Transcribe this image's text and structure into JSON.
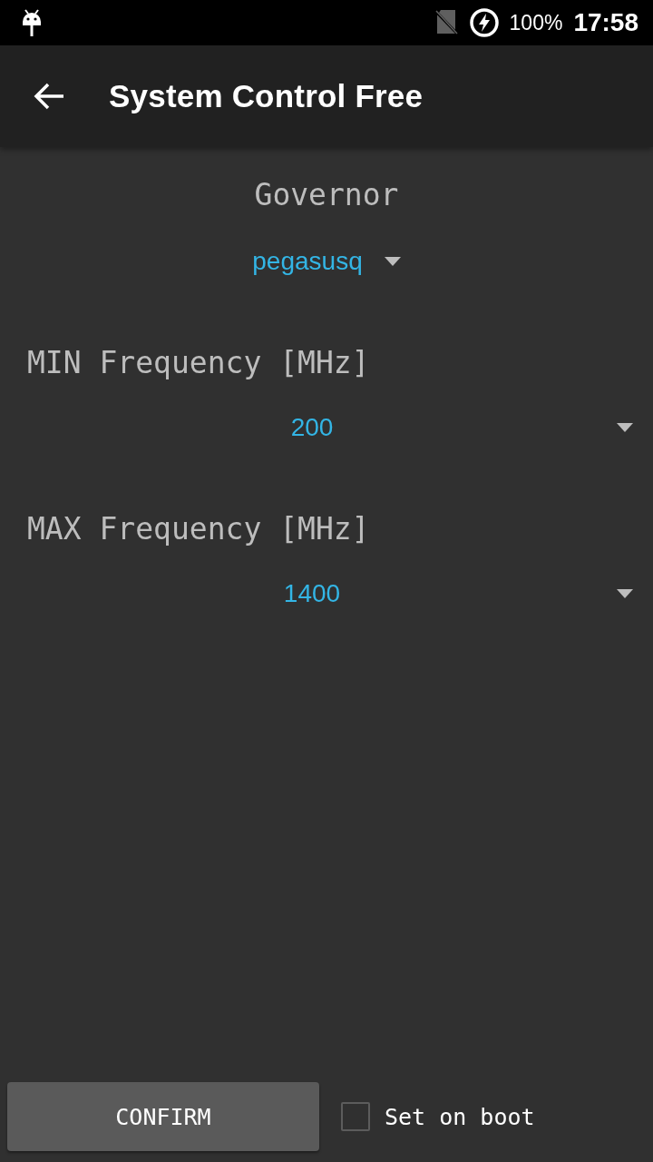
{
  "status_bar": {
    "battery": "100%",
    "time": "17:58"
  },
  "app_bar": {
    "title": "System Control Free"
  },
  "governor": {
    "label": "Governor",
    "value": "pegasusq"
  },
  "frequencies": [
    {
      "label": "MIN Frequency [MHz]",
      "value": "200"
    },
    {
      "label": "MAX Frequency [MHz]",
      "value": "1400"
    }
  ],
  "footer": {
    "confirm": "CONFIRM",
    "set_on_boot": {
      "label": "Set on boot",
      "checked": false
    }
  }
}
